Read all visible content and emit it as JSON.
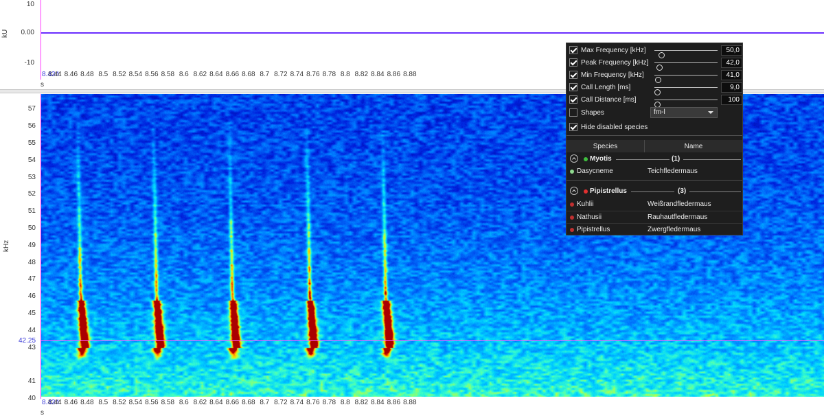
{
  "waveform": {
    "y_unit": "kU",
    "y_ticks": [
      "10",
      "0.00",
      "-10"
    ],
    "x_unit": "s",
    "x_start_label": "8.424",
    "x_ticks": [
      "8.44",
      "8.46",
      "8.48",
      "8.5",
      "8.52",
      "8.54",
      "8.56",
      "8.58",
      "8.6",
      "8.62",
      "8.64",
      "8.66",
      "8.68",
      "8.7",
      "8.72",
      "8.74",
      "8.76",
      "8.78",
      "8.8",
      "8.82",
      "8.84",
      "8.86",
      "8.88"
    ],
    "trace_color": "#6a2cff"
  },
  "spectrogram": {
    "y_unit": "kHz",
    "y_ticks": [
      "57",
      "56",
      "55",
      "54",
      "53",
      "52",
      "51",
      "50",
      "49",
      "48",
      "47",
      "46",
      "45",
      "44",
      "43",
      "41",
      "40"
    ],
    "cursor_label": "42.25",
    "cursor_color": "#ff5bff",
    "x_unit": "s",
    "x_start_label": "8.424",
    "x_ticks": [
      "8.44",
      "8.46",
      "8.48",
      "8.5",
      "8.52",
      "8.54",
      "8.56",
      "8.58",
      "8.6",
      "8.62",
      "8.64",
      "8.66",
      "8.68",
      "8.7",
      "8.72",
      "8.74",
      "8.76",
      "8.78",
      "8.8",
      "8.82",
      "8.84",
      "8.86",
      "8.88"
    ],
    "call_times_s": [
      8.478,
      8.572,
      8.666,
      8.762,
      8.856
    ]
  },
  "filter_panel": {
    "filters": [
      {
        "label": "Max Frequency [kHz]",
        "checked": true,
        "value": "50,0",
        "slider_level": 0.06
      },
      {
        "label": "Peak Frequency [kHz]",
        "checked": true,
        "value": "42,0",
        "slider_level": 0.03
      },
      {
        "label": "Min Frequency [kHz]",
        "checked": true,
        "value": "41,0",
        "slider_level": 0.01
      },
      {
        "label": "Call Length [ms]",
        "checked": true,
        "value": "9,0",
        "slider_level": 0.0
      },
      {
        "label": "Call Distance [ms]",
        "checked": true,
        "value": "100",
        "slider_level": 0.0
      }
    ],
    "shapes": {
      "label": "Shapes",
      "checked": false,
      "selected": "fm-l"
    },
    "hide_disabled": {
      "label": "Hide disabled species",
      "checked": true
    },
    "table_headers": {
      "species": "Species",
      "name": "Name"
    },
    "groups": [
      {
        "name": "Myotis",
        "count": "(1)",
        "color": "#3fbf3f",
        "species": [
          {
            "species": "Dasycneme",
            "name": "Teichfledermaus",
            "color": "#8fd98f"
          }
        ]
      },
      {
        "name": "Pipistrellus",
        "count": "(3)",
        "color": "#e03030",
        "species": [
          {
            "species": "Kuhlii",
            "name": "Weißrandfledermaus",
            "color": "#c03030"
          },
          {
            "species": "Nathusii",
            "name": "Rauhautfledermaus",
            "color": "#c03030"
          },
          {
            "species": "Pipistrellus",
            "name": "Zwergfledermaus",
            "color": "#c03030"
          }
        ]
      }
    ]
  }
}
